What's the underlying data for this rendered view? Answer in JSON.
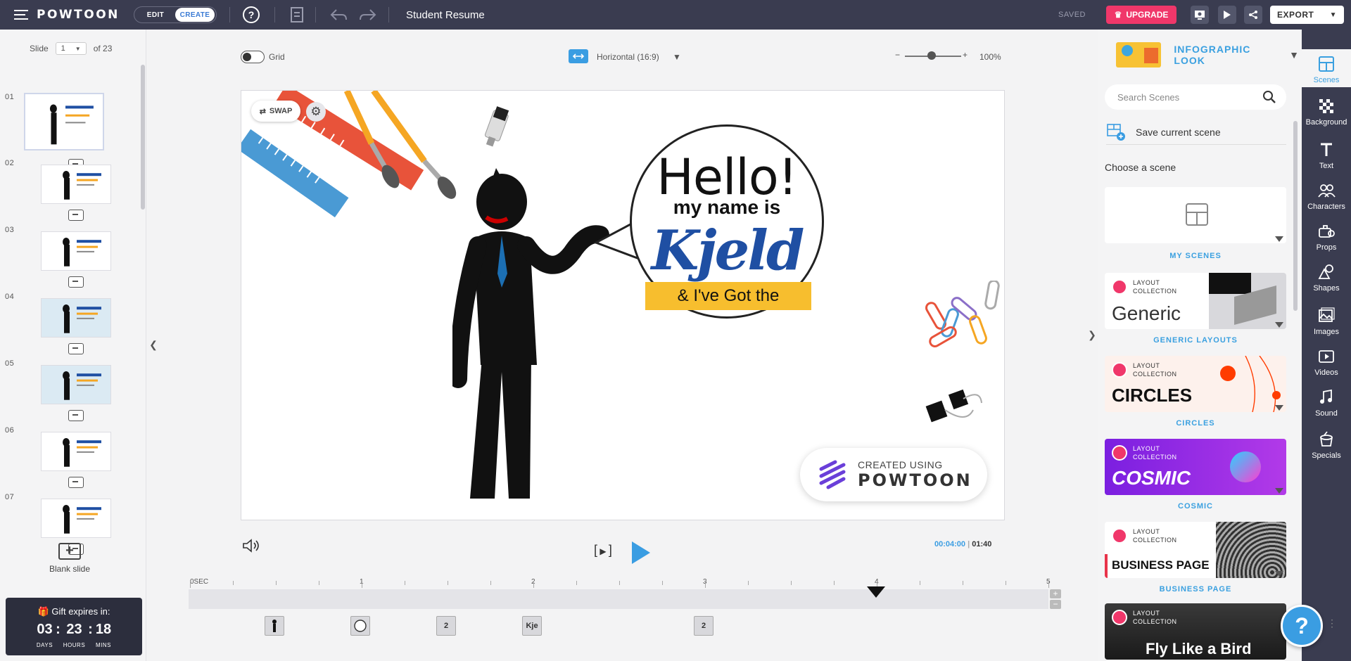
{
  "topbar": {
    "logo": "POWTOON",
    "mode_edit": "EDIT",
    "mode_create": "CREATE",
    "doc_title": "Student Resume",
    "saved": "SAVED",
    "upgrade": "UPGRADE",
    "export": "EXPORT"
  },
  "slides": {
    "label": "Slide",
    "current": "1",
    "of_label": "of 23",
    "items": [
      {
        "num": "01"
      },
      {
        "num": "02"
      },
      {
        "num": "03"
      },
      {
        "num": "04"
      },
      {
        "num": "05"
      },
      {
        "num": "06"
      },
      {
        "num": "07"
      }
    ],
    "blank_label": "Blank slide"
  },
  "gift": {
    "title": "Gift expires in:",
    "days": "03",
    "hours": "23",
    "mins": "18",
    "days_label": "DAYS",
    "hours_label": "HOURS",
    "mins_label": "MINS"
  },
  "canvas": {
    "grid_label": "Grid",
    "orientation": "Horizontal (16:9)",
    "zoom": "100%",
    "zoom_minus": "−",
    "zoom_plus": "+"
  },
  "scene": {
    "swap_label": "SWAP",
    "hello": "Hello!",
    "name_is": "my name is",
    "name": "Kjeld",
    "banner": "& I've Got the",
    "created_using": "CREATED USING",
    "powtoon": "POWTOON"
  },
  "playback": {
    "current_time": "00:04:00",
    "total_time": "01:40",
    "ticks": [
      "0SEC",
      "1",
      "2",
      "3",
      "4",
      "5"
    ],
    "elements": [
      "",
      "",
      "2",
      "Kje",
      "2"
    ]
  },
  "rightpanel": {
    "look_label": "INFOGRAPHIC LOOK",
    "search_placeholder": "Search Scenes",
    "save_scene": "Save current scene",
    "choose_scene": "Choose a scene",
    "layout_line1": "LAYOUT",
    "layout_line2": "COLLECTION",
    "cards": [
      {
        "label": "MY SCENES",
        "title": ""
      },
      {
        "label": "GENERIC LAYOUTS",
        "title": "Generic"
      },
      {
        "label": "CIRCLES",
        "title": "CIRCLES"
      },
      {
        "label": "COSMIC",
        "title": "COSMIC"
      },
      {
        "label": "BUSINESS PAGE",
        "title": "BUSINESS PAGE"
      },
      {
        "label": "",
        "title": "Fly Like a Bird"
      }
    ]
  },
  "rail": {
    "tools": [
      "Scenes",
      "Background",
      "Text",
      "Characters",
      "Props",
      "Shapes",
      "Images",
      "Videos",
      "Sound",
      "Specials"
    ]
  },
  "help": "?"
}
